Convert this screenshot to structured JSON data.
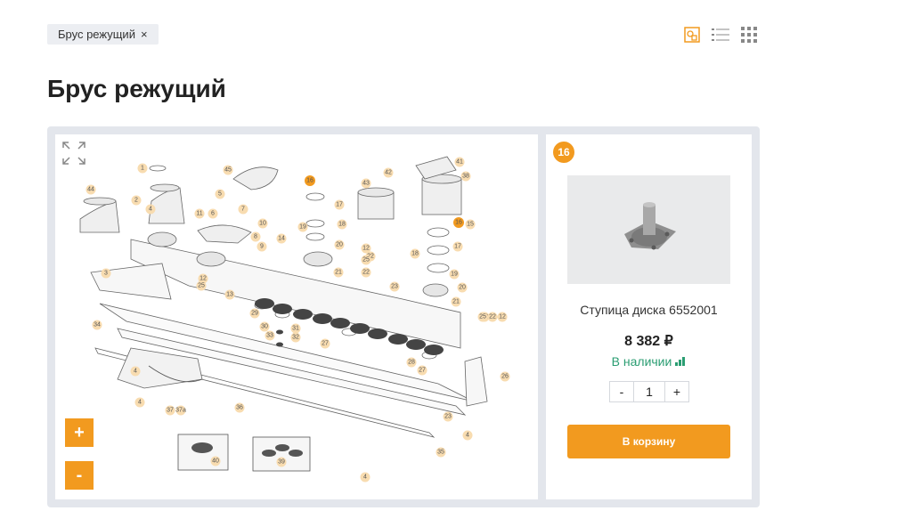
{
  "filter": {
    "label": "Брус режущий",
    "remove_symbol": "×"
  },
  "view_switch": {
    "icons": [
      "diagram-view-icon",
      "list-view-icon",
      "grid-view-icon"
    ],
    "active": "diagram-view-icon"
  },
  "page_title": "Брус режущий",
  "diagram": {
    "zoom_in_label": "+",
    "zoom_out_label": "-",
    "callouts": [
      "1",
      "2",
      "3",
      "4",
      "4",
      "4",
      "4",
      "4",
      "5",
      "6",
      "7",
      "8",
      "9",
      "10",
      "11",
      "12",
      "12",
      "12",
      "13",
      "14",
      "15",
      "16",
      "16",
      "17",
      "17",
      "18",
      "18",
      "19",
      "19",
      "20",
      "20",
      "21",
      "21",
      "22",
      "22",
      "23",
      "23",
      "25",
      "25",
      "25",
      "22",
      "12",
      "26",
      "27",
      "27",
      "28",
      "29",
      "30",
      "31",
      "32",
      "33",
      "34",
      "35",
      "36",
      "37",
      "37a",
      "38",
      "39",
      "40",
      "41",
      "42",
      "43",
      "44",
      "45"
    ],
    "highlighted_callout": "16"
  },
  "product_card": {
    "badge": "16",
    "name": "Ступица диска 6552001",
    "price": "8 382 ₽",
    "stock": "В наличии",
    "quantity": "1",
    "minus_label": "-",
    "plus_label": "+",
    "cart_label": "В корзину"
  },
  "colors": {
    "accent": "#f29a1f",
    "stock": "#2a9d72",
    "frame": "#e3e6ec"
  }
}
